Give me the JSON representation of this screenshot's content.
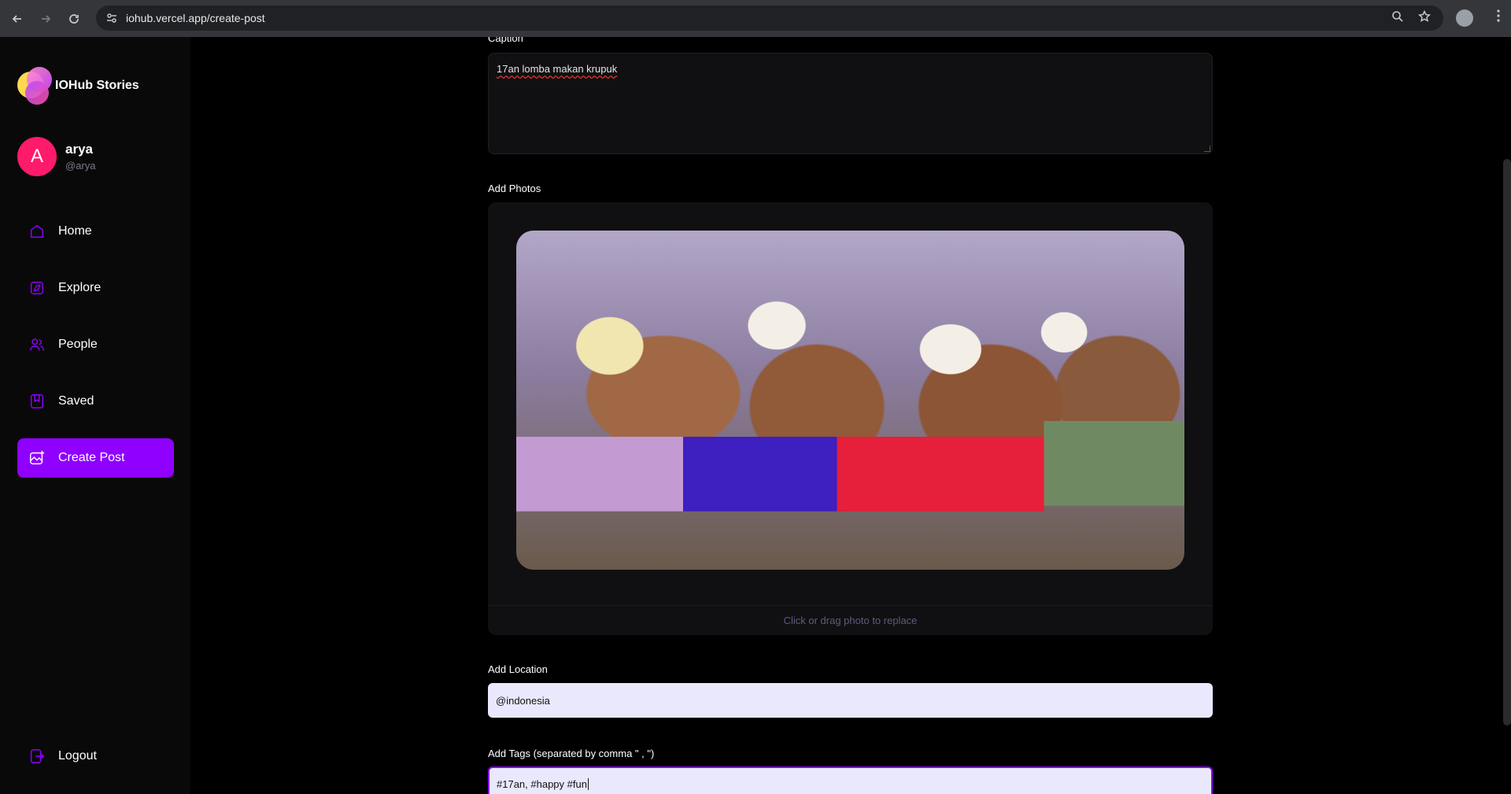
{
  "browser": {
    "url": "iohub.vercel.app/create-post"
  },
  "sidebar": {
    "logo_text": "IOHub Stories",
    "user": {
      "avatar_letter": "A",
      "name": "arya",
      "handle": "@arya"
    },
    "items": [
      {
        "label": "Home",
        "icon": "home-icon"
      },
      {
        "label": "Explore",
        "icon": "explore-icon"
      },
      {
        "label": "People",
        "icon": "people-icon"
      },
      {
        "label": "Saved",
        "icon": "bookmark-icon"
      },
      {
        "label": "Create Post",
        "icon": "create-post-icon",
        "active": true
      }
    ],
    "logout_label": "Logout",
    "accent_color": "#8f00ff"
  },
  "form": {
    "caption_label": "Caption",
    "caption_value": "17an lomba makan krupuk",
    "photos_label": "Add Photos",
    "photo_hint": "Click or drag photo to replace",
    "location_label": "Add Location",
    "location_value": "@indonesia",
    "tags_label": "Add Tags (separated by comma \" , \")",
    "tags_value": "#17an, #happy #fun"
  }
}
